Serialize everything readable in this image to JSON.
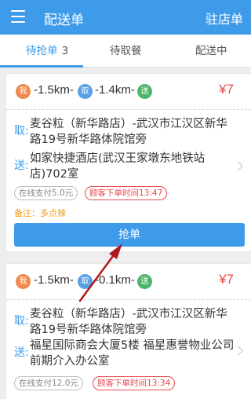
{
  "app": {
    "title": "配送单",
    "action_label": "驻店单"
  },
  "tabs": [
    {
      "label": "待抢单",
      "count": "3"
    },
    {
      "label": "待取餐"
    },
    {
      "label": "配送中"
    }
  ],
  "orders": [
    {
      "icon_me": "我",
      "icon_take": "取",
      "icon_send": "送",
      "dist_me_to_shop": "-1.5km-",
      "dist_shop_to_customer": "-1.4km-",
      "price": "¥7",
      "pickup_label": "取:",
      "pickup_address": "麦谷粒（新华路店）-武汉市江汉区新华路19号新华路体院馆旁",
      "delivery_label": "送:",
      "delivery_address": "如家快捷酒店(武汉王家墩东地铁站店)702室",
      "payment": "在线支付5.0元",
      "order_time": "顾客下单时间13:47",
      "note": "备注：多点辣",
      "button_label": "抢单"
    },
    {
      "icon_me": "我",
      "icon_take": "取",
      "icon_send": "送",
      "dist_me_to_shop": "-1.5km-",
      "dist_shop_to_customer": "-0.1km-",
      "price": "¥7",
      "pickup_label": "取:",
      "pickup_address": "麦谷粒（新华路店）-武汉市江汉区新华路19号新华路体院馆旁",
      "delivery_label": "送:",
      "delivery_address": "福星国际商会大厦5楼 福星惠誉物业公司 前期介入办公室",
      "payment": "在线支付12.0元",
      "order_time": "顾客下单时间13:34"
    }
  ],
  "colors": {
    "primary": "#3d9be9",
    "price_red": "#e8474a",
    "note_orange": "#f0a020",
    "icon_me": "#f0894d",
    "icon_take": "#5aa0e6",
    "icon_send": "#4db56a",
    "annotation_arrow": "#b01a1a"
  }
}
